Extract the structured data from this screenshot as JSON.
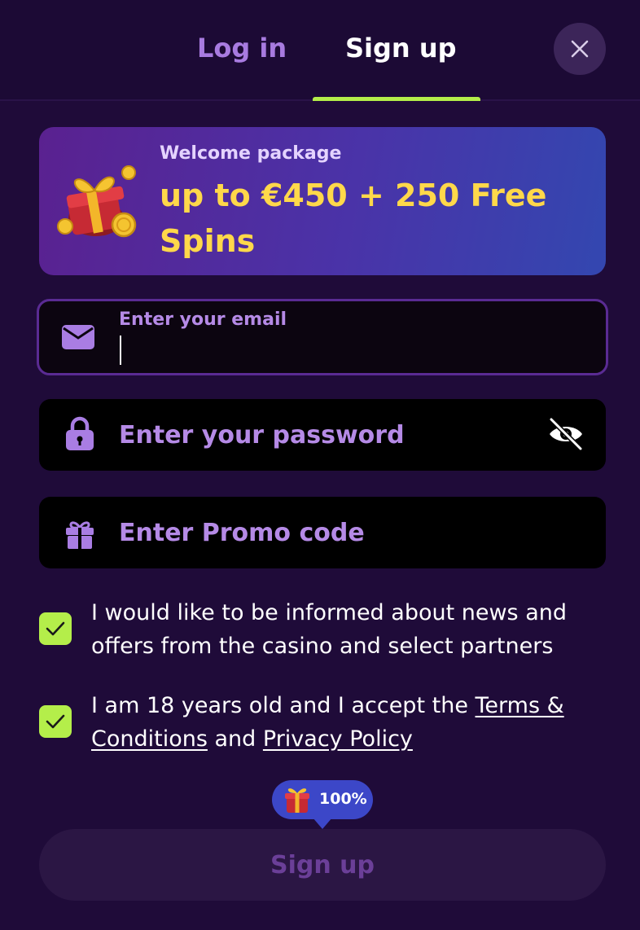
{
  "header": {
    "tabs": [
      {
        "label": "Log in",
        "active": false
      },
      {
        "label": "Sign up",
        "active": true
      }
    ],
    "close_icon": "close-icon"
  },
  "banner": {
    "label": "Welcome package",
    "amount": "up to €450 + 250 Free Spins",
    "icon": "gift-with-coins-icon"
  },
  "form": {
    "email": {
      "label": "Enter your email",
      "value": "",
      "icon": "envelope-icon"
    },
    "password": {
      "placeholder": "Enter your password",
      "value": "",
      "icon": "lock-icon",
      "toggle_icon": "eye-off-icon"
    },
    "promo": {
      "placeholder": "Enter Promo code",
      "value": "",
      "icon": "gift-icon"
    }
  },
  "consents": {
    "newsletter": {
      "checked": true,
      "text": "I would like to be informed about news and offers from the casino and select partners"
    },
    "terms": {
      "checked": true,
      "text_before": "I am 18 years old and I accept the ",
      "terms_link": "Terms & Conditions",
      "text_middle": " and ",
      "privacy_link": "Privacy Policy"
    }
  },
  "submit": {
    "bonus_badge": "100%",
    "label": "Sign up"
  },
  "colors": {
    "background": "#1f0b39",
    "accent_green": "#b4ee4a",
    "accent_purple": "#b58ae6",
    "banner_highlight": "#ffd84a",
    "badge_blue": "#3c47c8"
  }
}
